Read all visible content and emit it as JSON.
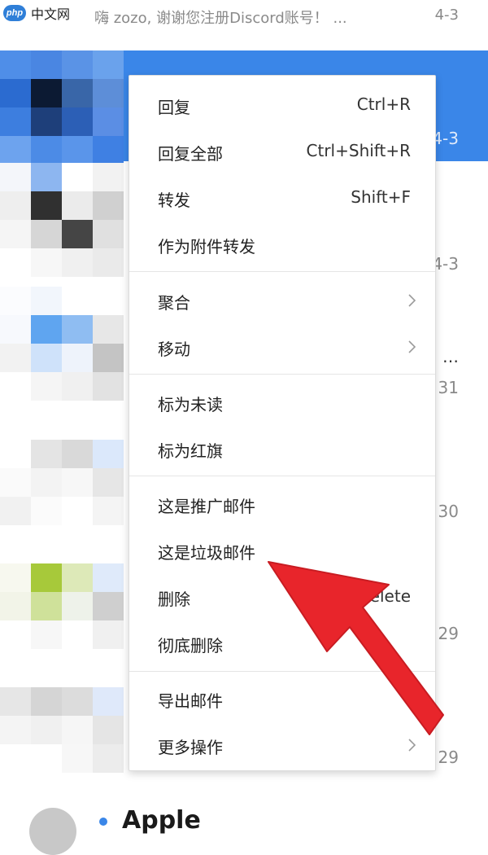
{
  "watermark": {
    "logo_text": "php",
    "site_text": "中文网"
  },
  "list": {
    "top_row": {
      "subject": "嗨 zozo, 谢谢您注册Discord账号！ ...",
      "date": "4-3"
    },
    "selected_row": {
      "date": "4-3"
    },
    "dates": [
      "4-3",
      "…",
      "31",
      "30",
      "29",
      "29"
    ],
    "bottom_row": {
      "sender": "Apple"
    }
  },
  "menu": {
    "items": [
      {
        "label": "回复",
        "shortcut": "Ctrl+R"
      },
      {
        "label": "回复全部",
        "shortcut": "Ctrl+Shift+R"
      },
      {
        "label": "转发",
        "shortcut": "Shift+F"
      },
      {
        "label": "作为附件转发",
        "shortcut": ""
      },
      {
        "label": "聚合",
        "shortcut": ""
      },
      {
        "label": "移动",
        "shortcut": ""
      },
      {
        "label": "标为未读",
        "shortcut": ""
      },
      {
        "label": "标为红旗",
        "shortcut": ""
      },
      {
        "label": "这是推广邮件",
        "shortcut": ""
      },
      {
        "label": "这是垃圾邮件",
        "shortcut": ""
      },
      {
        "label": "删除",
        "shortcut": "Delete"
      },
      {
        "label": "彻底删除",
        "shortcut": ""
      },
      {
        "label": "导出邮件",
        "shortcut": ""
      },
      {
        "label": "更多操作",
        "shortcut": ""
      }
    ]
  },
  "colors": {
    "accent": "#3a86e8",
    "annotation": "#e8252b"
  }
}
